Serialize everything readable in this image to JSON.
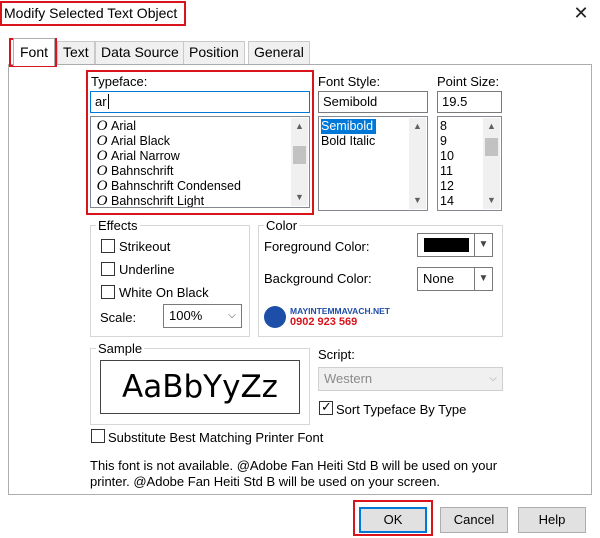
{
  "window": {
    "title": "Modify Selected Text Object",
    "close_glyph": "✕"
  },
  "tabs": [
    {
      "label": "Font"
    },
    {
      "label": "Text"
    },
    {
      "label": "Data Source"
    },
    {
      "label": "Position"
    },
    {
      "label": "General"
    }
  ],
  "typeface": {
    "label": "Typeface:",
    "value": "ar",
    "glyph": "O",
    "items": [
      "Arial",
      "Arial Black",
      "Arial Narrow",
      "Bahnschrift",
      "Bahnschrift Condensed",
      "Bahnschrift Light"
    ]
  },
  "font_style": {
    "label": "Font Style:",
    "value": "Semibold",
    "items": [
      "Semibold",
      "Bold Italic"
    ],
    "selected": "Semibold"
  },
  "point_size": {
    "label": "Point Size:",
    "value": "19.5",
    "items": [
      "8",
      "9",
      "10",
      "11",
      "12",
      "14"
    ]
  },
  "effects": {
    "title": "Effects",
    "strikeout": "Strikeout",
    "underline": "Underline",
    "white_on_black": "White On Black",
    "scale_label": "Scale:",
    "scale_value": "100%"
  },
  "color": {
    "title": "Color",
    "foreground_label": "Foreground Color:",
    "foreground_value": "#000000",
    "background_label": "Background Color:",
    "background_value": "None"
  },
  "watermark": {
    "line1": "MAYINTEMMAVACH.NET",
    "line2": "0902 923 569"
  },
  "sample": {
    "title": "Sample",
    "text": "AaBbYyZz"
  },
  "script": {
    "label": "Script:",
    "value": "Western"
  },
  "sort_typeface": {
    "label": "Sort Typeface By Type",
    "checked": true
  },
  "substitute": {
    "label": "Substitute Best Matching Printer Font",
    "checked": false
  },
  "message": {
    "line1": "This font is not available. @Adobe Fan Heiti Std B will be used on your",
    "line2": "printer. @Adobe Fan Heiti Std B will be used on your screen."
  },
  "buttons": {
    "ok": "OK",
    "cancel": "Cancel",
    "help": "Help"
  },
  "icons": {
    "dropdown": "▼",
    "scroll_up": "▲",
    "scroll_down": "▼"
  },
  "colors": {
    "highlight": "#d9141c",
    "selection": "#0078d7",
    "brand_blue": "#1d4ea8",
    "brand_red": "#d9141c"
  }
}
